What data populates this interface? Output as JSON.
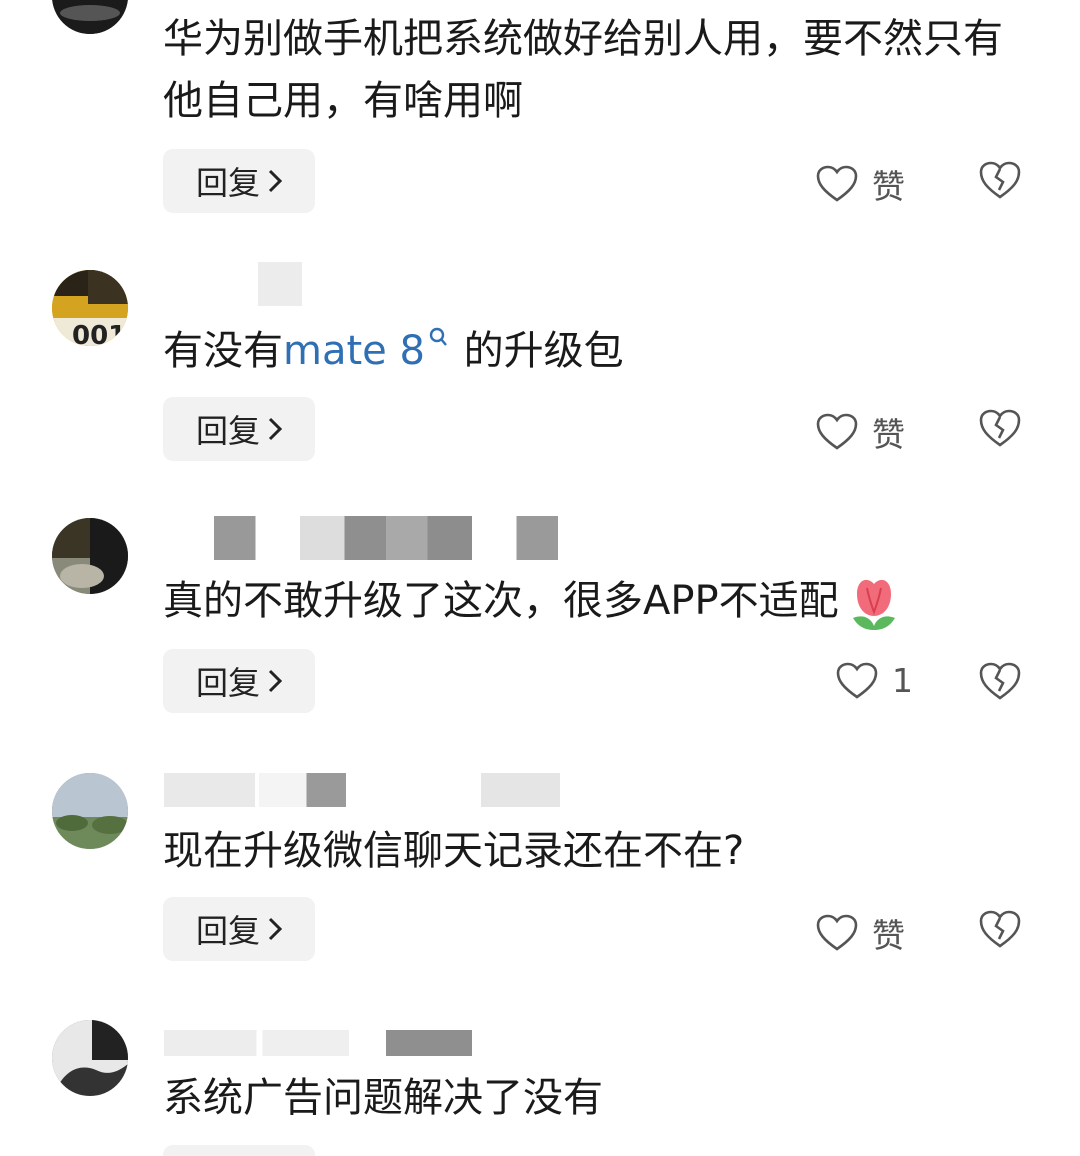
{
  "comments": [
    {
      "text": "华为别做手机把系统做好给别人用，要不然只有他自己用，有啥用啊",
      "reply_label": "回复",
      "like_label": "赞"
    },
    {
      "text_before": "有没有",
      "link": "mate 8",
      "text_after": " 的升级包",
      "reply_label": "回复",
      "like_label": "赞"
    },
    {
      "text": "真的不敢升级了这次，很多APP不适配",
      "emoji": "tulip-emoji",
      "reply_label": "回复",
      "like_label": "1"
    },
    {
      "text": "现在升级微信聊天记录还在不在?",
      "reply_label": "回复",
      "like_label": "赞"
    },
    {
      "text": "系统广告问题解决了没有"
    }
  ],
  "colors": {
    "link": "#2f6fb3",
    "button_bg": "#f2f2f2",
    "text": "#1a1a1a"
  },
  "icons": [
    "heart-icon",
    "broken-heart-icon",
    "chevron-right-icon",
    "search-icon"
  ]
}
